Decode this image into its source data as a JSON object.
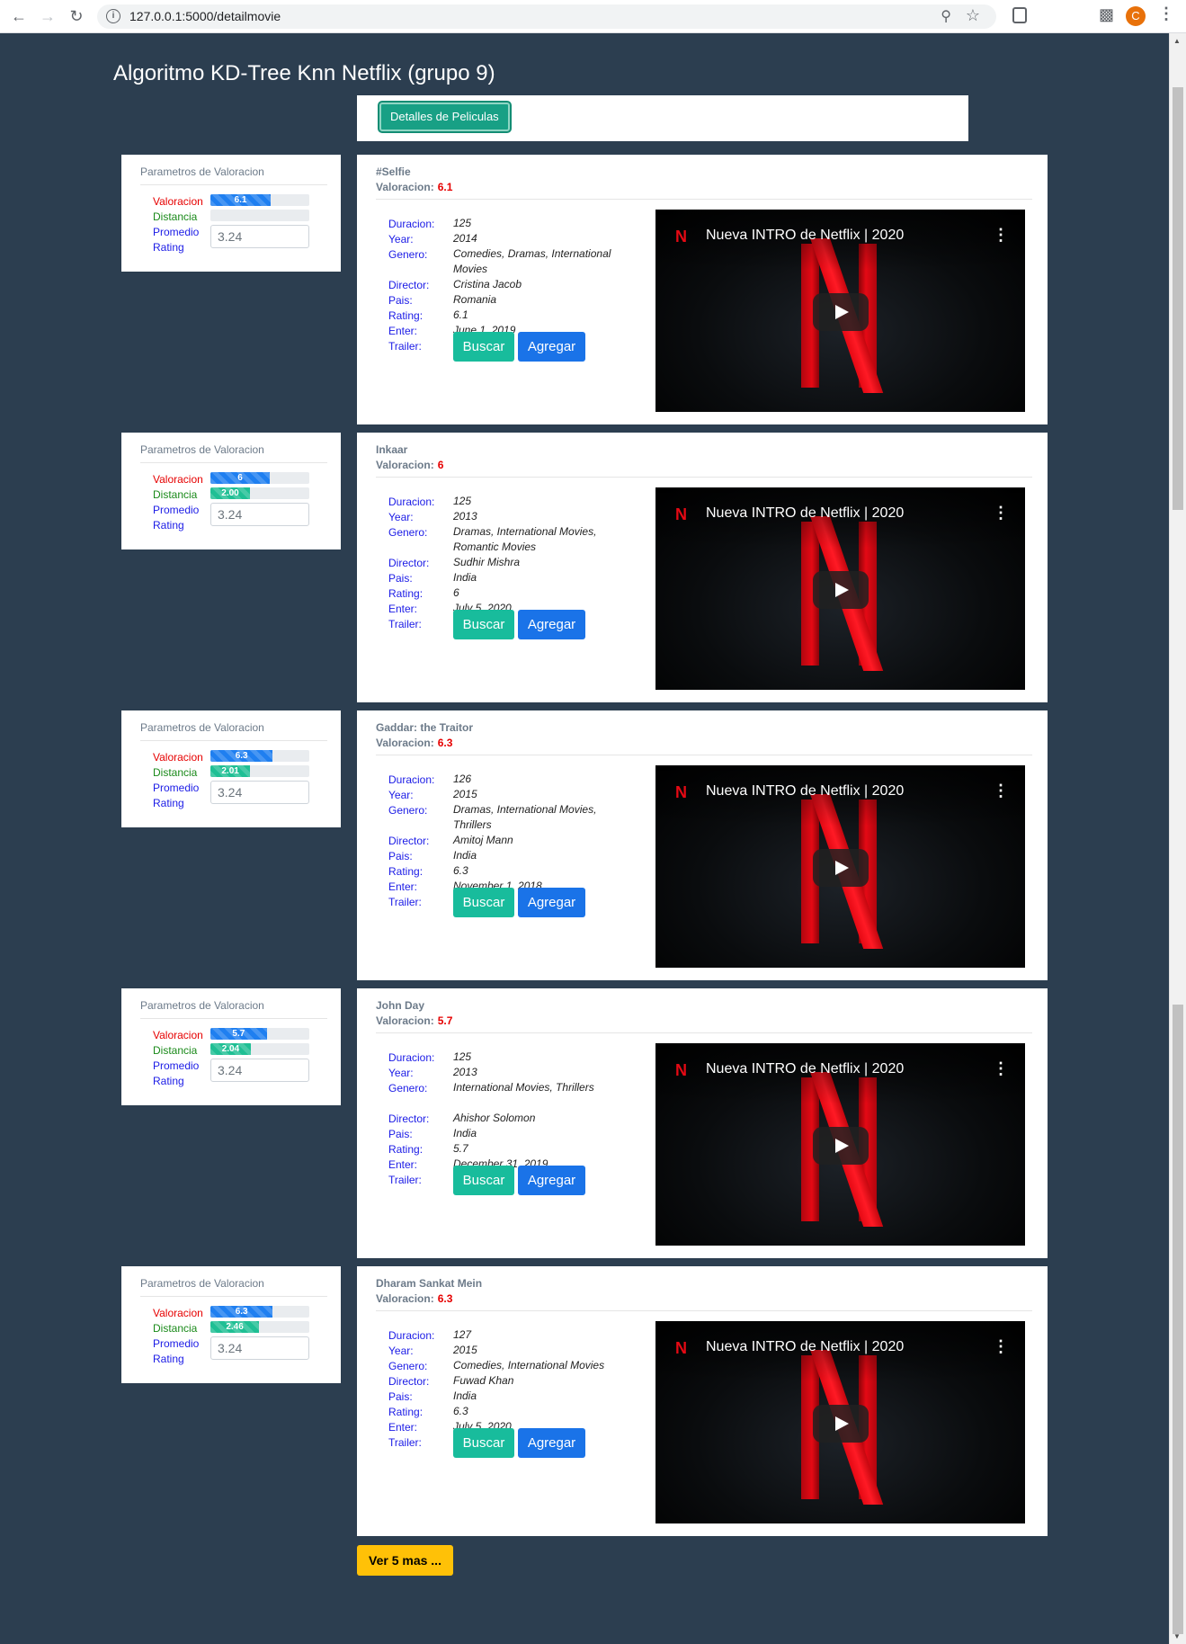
{
  "browser": {
    "url": "127.0.0.1:5000/detailmovie",
    "profile_initial": "C"
  },
  "page": {
    "title": "Algoritmo KD-Tree Knn Netflix (grupo 9)",
    "tab_label": "Detalles de Peliculas",
    "more_label": "Ver 5 mas ..."
  },
  "labels": {
    "params_title": "Parametros de Valoracion",
    "valoracion": "Valoracion",
    "distancia": "Distancia",
    "promedio": "Promedio",
    "rating": "Rating",
    "valoracion_head": "Valoracion:",
    "duracion": "Duracion:",
    "year": "Year:",
    "genero": "Genero:",
    "director": "Director:",
    "pais": "Pais:",
    "rating_row": "Rating:",
    "enter": "Enter:",
    "trailer": "Trailer:",
    "buscar": "Buscar",
    "agregar": "Agregar",
    "video_title": "Nueva INTRO de Netflix | 2020",
    "netflix_n": "N"
  },
  "colors": {
    "background": "#2c3e50",
    "accent_teal": "#18bc9c",
    "accent_blue": "#1a73e8",
    "more_button": "#ffc107",
    "rating_red": "#e60000"
  },
  "movies": [
    {
      "title": "#Selfie",
      "valoracion": "6.1",
      "valoracion_fraction": 0.61,
      "distancia": "",
      "distancia_fraction": 0,
      "promedio": "3.24",
      "duracion": "125",
      "year": "2014",
      "genero": "Comedies, Dramas, International Movies",
      "director": "Cristina Jacob",
      "pais": "Romania",
      "rating": "6.1",
      "enter": "June 1, 2019"
    },
    {
      "title": "Inkaar",
      "valoracion": "6",
      "valoracion_fraction": 0.6,
      "distancia": "2.00",
      "distancia_fraction": 0.4,
      "promedio": "3.24",
      "duracion": "125",
      "year": "2013",
      "genero": "Dramas, International Movies, Romantic Movies",
      "director": "Sudhir Mishra",
      "pais": "India",
      "rating": "6",
      "enter": "July 5, 2020"
    },
    {
      "title": "Gaddar: the Traitor",
      "valoracion": "6.3",
      "valoracion_fraction": 0.63,
      "distancia": "2.01",
      "distancia_fraction": 0.402,
      "promedio": "3.24",
      "duracion": "126",
      "year": "2015",
      "genero": "Dramas, International Movies, Thrillers",
      "director": "Amitoj Mann",
      "pais": "India",
      "rating": "6.3",
      "enter": "November 1, 2018"
    },
    {
      "title": "John Day",
      "valoracion": "5.7",
      "valoracion_fraction": 0.57,
      "distancia": "2.04",
      "distancia_fraction": 0.408,
      "promedio": "3.24",
      "duracion": "125",
      "year": "2013",
      "genero": "International Movies, Thrillers",
      "director": "Ahishor Solomon",
      "pais": "India",
      "rating": "5.7",
      "enter": "December 31, 2019"
    },
    {
      "title": "Dharam Sankat Mein",
      "valoracion": "6.3",
      "valoracion_fraction": 0.63,
      "distancia": "2.46",
      "distancia_fraction": 0.492,
      "promedio": "3.24",
      "duracion": "127",
      "year": "2015",
      "genero": "Comedies, International Movies",
      "director": "Fuwad Khan",
      "pais": "India",
      "rating": "6.3",
      "enter": "July 5, 2020"
    }
  ]
}
